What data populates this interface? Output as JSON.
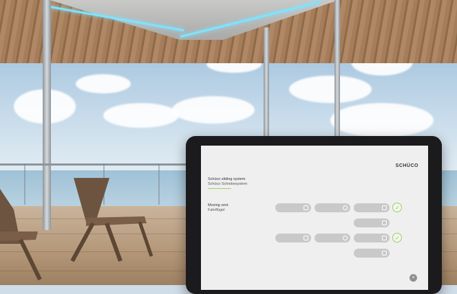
{
  "brand": {
    "logo_text": "SCHÜCO"
  },
  "system": {
    "title": "Schüco sliding system",
    "subtitle": "Schüco Schiebesystem"
  },
  "vent": {
    "title": "Moving vent",
    "subtitle": "Fahrflügel"
  },
  "controls": [
    {
      "row": 1,
      "label": ""
    },
    {
      "row": 1,
      "label": ""
    },
    {
      "row": 1,
      "label": ""
    },
    {
      "row": 2,
      "label": ""
    },
    {
      "row": 3,
      "label": ""
    },
    {
      "row": 3,
      "label": ""
    },
    {
      "row": 3,
      "label": ""
    },
    {
      "row": 4,
      "label": ""
    }
  ],
  "icons": {
    "check": "✓",
    "close": "×"
  },
  "colors": {
    "accent": "#8bbf57",
    "led": "#7fe3ff"
  }
}
